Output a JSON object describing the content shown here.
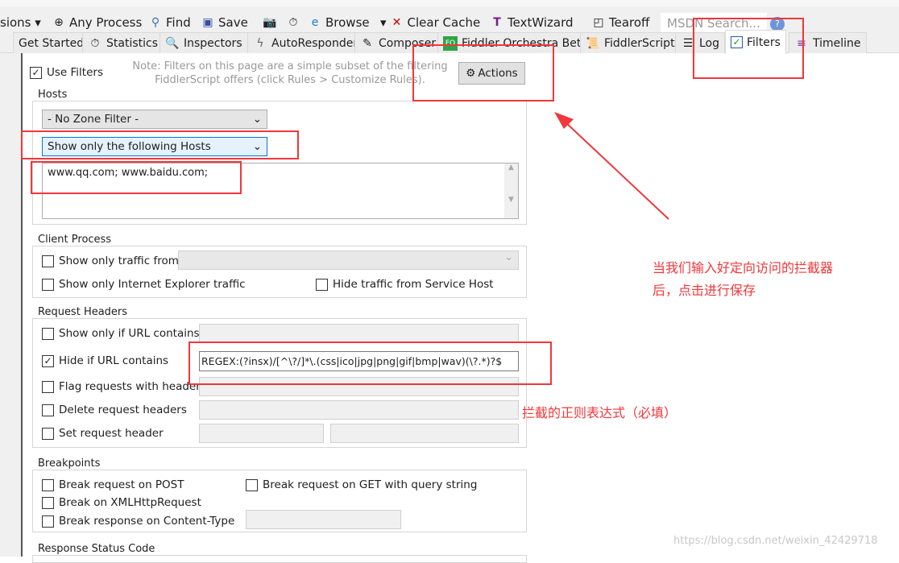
{
  "toolbar": {
    "items": [
      "sions ▾",
      "Any Process",
      "Find",
      "Save",
      "Browse",
      "Clear Cache",
      "TextWizard",
      "Tearoff"
    ],
    "search_placeholder": "MSDN Search..."
  },
  "tabs": [
    "Get Started",
    "Statistics",
    "Inspectors",
    "AutoResponder",
    "Composer",
    "Fiddler Orchestra Beta",
    "FiddlerScript",
    "Log",
    "Filters",
    "Timeline"
  ],
  "filters": {
    "use_filters": "Use Filters",
    "use_filters_checked": true,
    "note": "Note: Filters on this page are a simple subset of the filtering FiddlerScript offers (click Rules > Customize Rules).",
    "actions": "Actions",
    "hosts": {
      "label": "Hosts",
      "zone": "- No Zone Filter -",
      "mode": "Show only the following Hosts",
      "hosts_value": "www.qq.com; www.baidu.com;"
    },
    "client": {
      "label": "Client Process",
      "traffic_from": "Show only traffic from",
      "ie": "Show only Internet Explorer traffic",
      "service_host": "Hide traffic from Service Host"
    },
    "request_headers": {
      "label": "Request Headers",
      "url_contains": "Show only if URL contains",
      "hide_url": "Hide if URL contains",
      "hide_url_checked": true,
      "hide_url_value": "REGEX:(?insx)/[^\\?/]*\\.(css|ico|jpg|png|gif|bmp|wav)(\\?.*)?$",
      "flag": "Flag requests with headers",
      "delete": "Delete request headers",
      "set": "Set request header"
    },
    "breakpoints": {
      "label": "Breakpoints",
      "post": "Break request on POST",
      "get": "Break request on GET with query string",
      "xhr": "Break on XMLHttpRequest",
      "content_type": "Break response on Content-Type"
    },
    "response_status": {
      "label": "Response Status Code"
    }
  },
  "annotations": {
    "note1a": "当我们输入好定向访问的拦截器",
    "note1b": "后，点击进行保存",
    "note2": "拦截的正则表达式（必填）",
    "color": "#f0373a"
  },
  "watermark": "https://blog.csdn.net/weixin_42429718"
}
